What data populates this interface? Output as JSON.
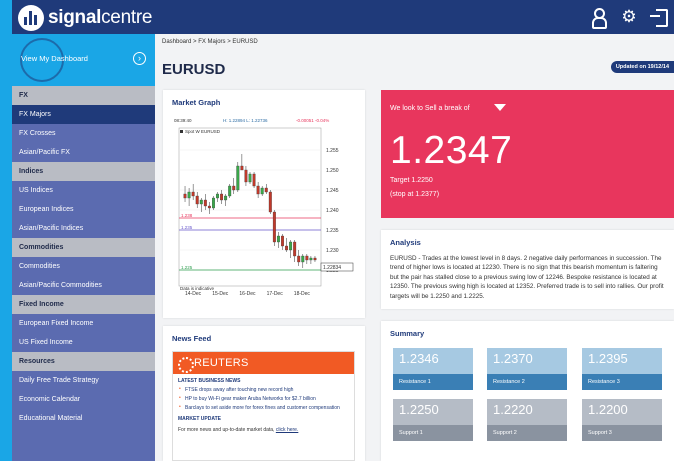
{
  "app": {
    "brand_bold": "signal",
    "brand_light": "centre"
  },
  "sidebar": {
    "dashboard_label": "View My Dashboard",
    "items": [
      {
        "label": "FX",
        "type": "head"
      },
      {
        "label": "FX Majors",
        "type": "active"
      },
      {
        "label": "FX Crosses",
        "type": "item"
      },
      {
        "label": "Asian/Pacific FX",
        "type": "item"
      },
      {
        "label": "Indices",
        "type": "head"
      },
      {
        "label": "US Indices",
        "type": "item"
      },
      {
        "label": "European Indices",
        "type": "item"
      },
      {
        "label": "Asian/Pacific Indices",
        "type": "item"
      },
      {
        "label": "Commodities",
        "type": "head"
      },
      {
        "label": "Commodities",
        "type": "item"
      },
      {
        "label": "Asian/Pacific Commodities",
        "type": "item"
      },
      {
        "label": "Fixed Income",
        "type": "head"
      },
      {
        "label": "European Fixed Income",
        "type": "item"
      },
      {
        "label": "US Fixed Income",
        "type": "item"
      },
      {
        "label": "Resources",
        "type": "head"
      },
      {
        "label": "Daily Free Trade Strategy",
        "type": "item"
      },
      {
        "label": "Economic Calendar",
        "type": "item"
      },
      {
        "label": "Educational Material",
        "type": "item"
      }
    ]
  },
  "breadcrumb": "Dashboard > FX Majors > EURUSD",
  "page_title": "EURUSD",
  "updated": "Updated on 19/12/14",
  "market_graph": {
    "title": "Market Graph",
    "time": "08:39:40",
    "hl": "H: 1.22894  L: 1.22736",
    "change": "-0.00051  -0.04%",
    "legend": "Spot W EURUSD",
    "data_note": "Data is indicative",
    "price_tag": "1.22834",
    "level_labels": [
      "1.238",
      "1.235",
      "1.225"
    ]
  },
  "signal": {
    "headline": "We look to Sell a break of",
    "price": "1.2347",
    "target": "Target 1.2250",
    "stop": "(stop at 1.2377)"
  },
  "analysis": {
    "title": "Analysis",
    "text": "EURUSD - Trades at the lowest level in 8 days. 2 negative daily performances in succession. The trend of higher lows is located at 12230. There is no sign that this bearish momentum is faltering but the pair has stalled close to a previous swing low of 12246. Bespoke resistance is located at 12350. The previous swing high is located at 12352. Preferred trade is to sell into rallies. Our profit targets will be 1.2250 and 1.2225."
  },
  "news": {
    "title": "News Feed",
    "provider": "REUTERS",
    "latest_head": "LATEST BUSINESS NEWS",
    "items": [
      "FTSE drops away after touching new record high",
      "HP to buy Wi-Fi gear maker Aruba Networks for $2.7 billion",
      "Barclays to set aside more for forex fines and customer compensation"
    ],
    "update_head": "MARKET UPDATE",
    "more_text": "For more news and up-to-date market data,",
    "more_link": "click here."
  },
  "summary": {
    "title": "Summary",
    "resistance": [
      {
        "value": "1.2346",
        "label": "Resistance 1"
      },
      {
        "value": "1.2370",
        "label": "Resistance 2"
      },
      {
        "value": "1.2395",
        "label": "Resistance 3"
      }
    ],
    "support": [
      {
        "value": "1.2250",
        "label": "Support 1"
      },
      {
        "value": "1.2220",
        "label": "Support 2"
      },
      {
        "value": "1.2200",
        "label": "Support 3"
      }
    ]
  },
  "colors": {
    "navy": "#1f3a7a",
    "sky": "#1aa6e6",
    "sidebar": "#5b6bb0",
    "sell": "#e8365d",
    "resistance": "#3a7fb5",
    "support": "#8a93a0"
  },
  "chart_data": {
    "type": "candlestick",
    "title": "",
    "x_ticks": [
      "14-Dec",
      "15-Dec",
      "16-Dec",
      "17-Dec",
      "18-Dec"
    ],
    "y_ticks": [
      "1.255",
      "1.250",
      "1.245",
      "1.240",
      "1.235",
      "1.230",
      "1.225"
    ],
    "ylim": [
      1.222,
      1.258
    ],
    "levels": [
      {
        "value": 1.238,
        "color": "#e8365d"
      },
      {
        "value": 1.235,
        "color": "#6a5acd"
      },
      {
        "value": 1.225,
        "color": "#2e9e4f"
      }
    ],
    "series": [
      {
        "values": [
          {
            "o": 1.244,
            "h": 1.246,
            "l": 1.242,
            "c": 1.243
          },
          {
            "o": 1.243,
            "h": 1.2455,
            "l": 1.241,
            "c": 1.2445
          },
          {
            "o": 1.2445,
            "h": 1.2465,
            "l": 1.2425,
            "c": 1.2435
          },
          {
            "o": 1.2435,
            "h": 1.2445,
            "l": 1.2405,
            "c": 1.2415
          },
          {
            "o": 1.2415,
            "h": 1.243,
            "l": 1.2395,
            "c": 1.2425
          },
          {
            "o": 1.2425,
            "h": 1.244,
            "l": 1.24,
            "c": 1.241
          },
          {
            "o": 1.241,
            "h": 1.242,
            "l": 1.239,
            "c": 1.2405
          },
          {
            "o": 1.2405,
            "h": 1.2435,
            "l": 1.24,
            "c": 1.243
          },
          {
            "o": 1.243,
            "h": 1.2445,
            "l": 1.242,
            "c": 1.244
          },
          {
            "o": 1.244,
            "h": 1.245,
            "l": 1.2415,
            "c": 1.2425
          },
          {
            "o": 1.2425,
            "h": 1.244,
            "l": 1.241,
            "c": 1.2435
          },
          {
            "o": 1.2435,
            "h": 1.2465,
            "l": 1.243,
            "c": 1.246
          },
          {
            "o": 1.246,
            "h": 1.248,
            "l": 1.244,
            "c": 1.245
          },
          {
            "o": 1.245,
            "h": 1.252,
            "l": 1.2445,
            "c": 1.251
          },
          {
            "o": 1.251,
            "h": 1.254,
            "l": 1.25,
            "c": 1.25
          },
          {
            "o": 1.25,
            "h": 1.251,
            "l": 1.246,
            "c": 1.247
          },
          {
            "o": 1.247,
            "h": 1.2495,
            "l": 1.2465,
            "c": 1.249
          },
          {
            "o": 1.249,
            "h": 1.2495,
            "l": 1.2455,
            "c": 1.246
          },
          {
            "o": 1.246,
            "h": 1.247,
            "l": 1.243,
            "c": 1.244
          },
          {
            "o": 1.244,
            "h": 1.246,
            "l": 1.2435,
            "c": 1.2455
          },
          {
            "o": 1.2455,
            "h": 1.2465,
            "l": 1.244,
            "c": 1.2445
          },
          {
            "o": 1.2445,
            "h": 1.245,
            "l": 1.239,
            "c": 1.2395
          },
          {
            "o": 1.2395,
            "h": 1.24,
            "l": 1.231,
            "c": 1.232
          },
          {
            "o": 1.232,
            "h": 1.2345,
            "l": 1.2305,
            "c": 1.2335
          },
          {
            "o": 1.2335,
            "h": 1.234,
            "l": 1.23,
            "c": 1.231
          },
          {
            "o": 1.231,
            "h": 1.233,
            "l": 1.2295,
            "c": 1.23
          },
          {
            "o": 1.23,
            "h": 1.2325,
            "l": 1.228,
            "c": 1.232
          },
          {
            "o": 1.232,
            "h": 1.2325,
            "l": 1.227,
            "c": 1.2285
          },
          {
            "o": 1.2285,
            "h": 1.23,
            "l": 1.226,
            "c": 1.227
          },
          {
            "o": 1.227,
            "h": 1.229,
            "l": 1.2255,
            "c": 1.2285
          },
          {
            "o": 1.2285,
            "h": 1.229,
            "l": 1.2265,
            "c": 1.2275
          },
          {
            "o": 1.2275,
            "h": 1.2285,
            "l": 1.2265,
            "c": 1.228
          },
          {
            "o": 1.228,
            "h": 1.2285,
            "l": 1.227,
            "c": 1.2275
          }
        ]
      }
    ]
  }
}
